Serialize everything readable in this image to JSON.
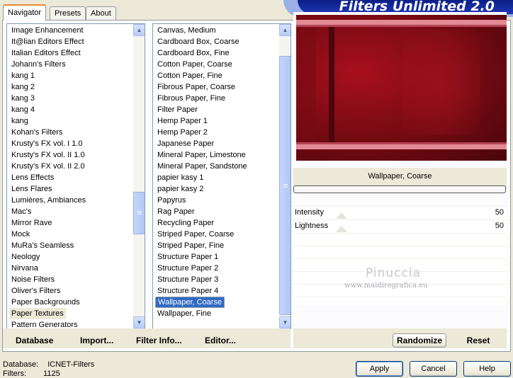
{
  "tabs": [
    {
      "label": "Navigator",
      "active": true
    },
    {
      "label": "Presets",
      "active": false
    },
    {
      "label": "About",
      "active": false
    }
  ],
  "app_title": "Filters Unlimited 2.0",
  "categories": [
    "Image Enhancement",
    "It@lian Editors Effect",
    "Italian Editors Effect",
    "Johann's Filters",
    "kang 1",
    "kang 2",
    "kang 3",
    "kang 4",
    "kang",
    "Kohan's Filters",
    "Krusty's FX vol. I 1.0",
    "Krusty's FX vol. II 1.0",
    "Krusty's FX vol. II 2.0",
    "Lens Effects",
    "Lens Flares",
    "Lumières, Ambiances",
    "Mac's",
    "Mirror Rave",
    "Mock",
    "MuRa's Seamless",
    "Neology",
    "Nirvana",
    "Noise Filters",
    "Oliver's Filters",
    "Paper Backgrounds",
    "Paper Textures",
    "Pattern Generators"
  ],
  "selected_category": "Paper Textures",
  "filters": [
    "Canvas, Medium",
    "Cardboard Box, Coarse",
    "Cardboard Box, Fine",
    "Cotton Paper, Coarse",
    "Cotton Paper, Fine",
    "Fibrous Paper, Coarse",
    "Fibrous Paper, Fine",
    "Filter Paper",
    "Hemp Paper 1",
    "Hemp Paper 2",
    "Japanese Paper",
    "Mineral Paper, Limestone",
    "Mineral Paper, Sandstone",
    "papier kasy 1",
    "papier kasy 2",
    "Papyrus",
    "Rag Paper",
    "Recycling Paper",
    "Striped Paper, Coarse",
    "Striped Paper, Fine",
    "Structure Paper 1",
    "Structure Paper 2",
    "Structure Paper 3",
    "Structure Paper 4",
    "Wallpaper, Coarse",
    "Wallpaper, Fine"
  ],
  "selected_filter": "Wallpaper, Coarse",
  "filter_name": "Wallpaper, Coarse",
  "progress": 0,
  "sliders": [
    {
      "label": "Intensity",
      "value": "50",
      "fraction": 0.2
    },
    {
      "label": "Lightness",
      "value": "50",
      "fraction": 0.2
    }
  ],
  "watermark": {
    "line1": "Pinuccia",
    "line2": "www.maidiregrafica.eu"
  },
  "toolbar": {
    "database": "Database",
    "import": "Import...",
    "filter_info": "Filter Info...",
    "editor": "Editor...",
    "randomize": "Randomize",
    "reset": "Reset"
  },
  "status": {
    "database_label": "Database:",
    "database_value": "ICNET-Filters",
    "filters_label": "Filters:",
    "filters_value": "1125"
  },
  "buttons": {
    "apply": "Apply",
    "cancel": "Cancel",
    "help": "Help"
  },
  "colors": {
    "selection": "#316ac5",
    "logo": "#0c1f86",
    "preview_base": "#7c0b14",
    "preview_band": "#e28a96"
  },
  "icons": {
    "scroll_up": "scroll-up-arrow",
    "scroll_down": "scroll-down-arrow"
  }
}
